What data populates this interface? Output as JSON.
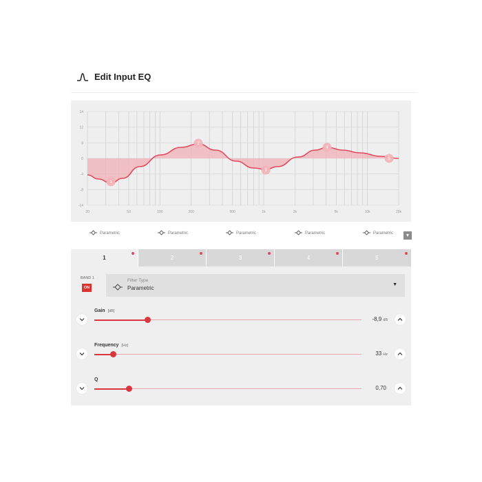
{
  "header": {
    "title": "Edit Input EQ",
    "icon": "bell-curve-icon"
  },
  "graph": {
    "y_labels": [
      "14",
      "12",
      "8",
      "0",
      "-4",
      "-8",
      "-14"
    ],
    "x_labels": [
      "20",
      "50",
      "100",
      "200",
      "500",
      "1k",
      "2k",
      "5k",
      "10k",
      "20k"
    ],
    "band_markers": [
      "1",
      "2",
      "3",
      "4",
      "5"
    ],
    "colors": {
      "curve": "#e04a5e",
      "fill": "#f0b0b6",
      "marker": "#f2b3bb"
    }
  },
  "band_strip": {
    "items": [
      "Parametric",
      "Parametric",
      "Parametric",
      "Parametric",
      "Parametric"
    ],
    "menu_icon": "chevron-down-icon"
  },
  "tabs": [
    "1",
    "2",
    "3",
    "4",
    "5"
  ],
  "band": {
    "label": "BAND 1",
    "on_label": "ON",
    "filter_caption": "Filter Type",
    "filter_value": "Parametric"
  },
  "params": [
    {
      "name": "Gain",
      "unit": "[dB]",
      "value": "-8,9",
      "value_unit": "dB",
      "level": 0.2
    },
    {
      "name": "Frequency",
      "unit": "[Hz]",
      "value": "33",
      "value_unit": "Hz",
      "level": 0.07
    },
    {
      "name": "Q",
      "unit": "",
      "value": "0,70",
      "value_unit": "",
      "level": 0.13
    }
  ],
  "accent_color": "#d9363e"
}
